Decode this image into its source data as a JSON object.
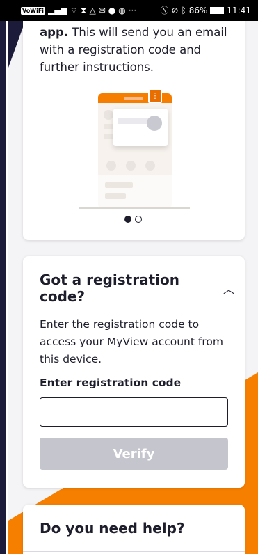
{
  "statusbar": {
    "volte": "VoWiFi",
    "battery": "86%",
    "time": "11:41",
    "battery_level": 0.86
  },
  "onboarding": {
    "intro_bold": "app.",
    "intro_text": " This will send you an email with a registration code and further instructions.",
    "carousel_active_index": 0,
    "carousel_count": 2
  },
  "registration": {
    "title": "Got a registration code?",
    "description": "Enter the registration code to access your MyView account from this device.",
    "field_label": "Enter registration code",
    "field_value": "",
    "verify_label": "Verify"
  },
  "help": {
    "title": "Do you need help?"
  },
  "colors": {
    "accent_orange": "#f77f00",
    "navy": "#1c1b3a",
    "disabled_button": "#c5c5cd"
  }
}
